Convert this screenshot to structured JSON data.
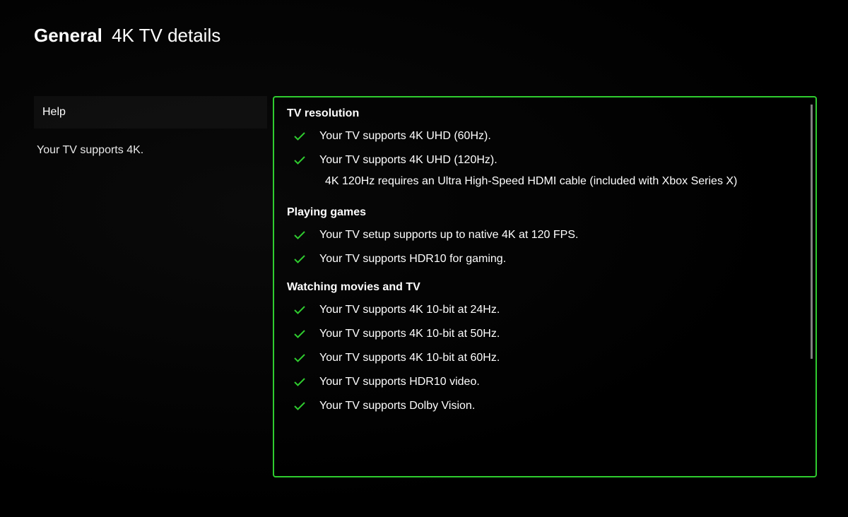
{
  "breadcrumb": {
    "category": "General",
    "page": "4K TV details"
  },
  "sidebar": {
    "help_label": "Help",
    "status_text": "Your TV supports 4K."
  },
  "sections": {
    "tv_resolution": {
      "title": "TV resolution",
      "items": {
        "uhd_60": "Your TV supports 4K UHD (60Hz).",
        "uhd_120": "Your TV supports 4K UHD (120Hz).",
        "note_120": "4K 120Hz requires an Ultra High-Speed HDMI cable (included with Xbox Series X)"
      }
    },
    "playing_games": {
      "title": "Playing games",
      "items": {
        "native_4k": "Your TV setup supports up to native 4K at 120 FPS.",
        "hdr10_gaming": "Your TV supports HDR10 for gaming."
      }
    },
    "watching": {
      "title": "Watching movies and TV",
      "items": {
        "bit_24": "Your TV supports 4K 10-bit at 24Hz.",
        "bit_50": "Your TV supports 4K 10-bit at 50Hz.",
        "bit_60": "Your TV supports 4K 10-bit at 60Hz.",
        "hdr10_video": "Your TV supports HDR10 video.",
        "dolby_vision": "Your TV supports Dolby Vision."
      }
    }
  },
  "colors": {
    "accent": "#2fcc2f"
  }
}
